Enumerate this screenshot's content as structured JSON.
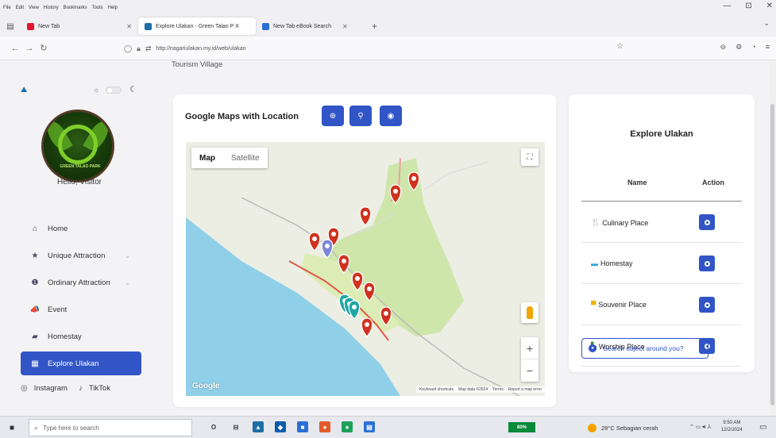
{
  "browser": {
    "menu": [
      "File",
      "Edit",
      "View",
      "History",
      "Bookmarks",
      "Tools",
      "Help"
    ],
    "tabs": [
      {
        "title": "New Tab",
        "active": false,
        "favicon_color": "#e0162b"
      },
      {
        "title": "Explore Ulakan - Green Talao P X",
        "active": true,
        "favicon_color": "#1d6fa5"
      },
      {
        "title": "New Tab eBook Search",
        "active": false,
        "favicon_color": "#2b6fd6"
      }
    ],
    "url": "http://nagariulakan.my.id/web/ulakan",
    "window_controls": [
      "—",
      "⊡",
      "✕"
    ]
  },
  "sidebar": {
    "greeting": "Hello, Visitor",
    "logo_text": "GREEN TALAO PARK",
    "items": [
      {
        "label": "Home",
        "icon": "home-icon",
        "glyph": "⌂",
        "has_caret": false,
        "active": false
      },
      {
        "label": "Unique Attraction",
        "icon": "star-icon",
        "glyph": "★",
        "has_caret": true,
        "active": false
      },
      {
        "label": "Ordinary Attraction",
        "icon": "info-icon",
        "glyph": "❶",
        "has_caret": true,
        "active": false
      },
      {
        "label": "Event",
        "icon": "megaphone-icon",
        "glyph": "📣",
        "has_caret": false,
        "active": false
      },
      {
        "label": "Homestay",
        "icon": "bed-icon",
        "glyph": "▰",
        "has_caret": false,
        "active": false
      },
      {
        "label": "Explore Ulakan",
        "icon": "map-icon",
        "glyph": "▦",
        "has_caret": false,
        "active": true
      }
    ],
    "social": [
      {
        "label": "Instagram",
        "icon": "instagram-icon"
      },
      {
        "label": "TikTok",
        "icon": "tiktok-icon"
      }
    ]
  },
  "page": {
    "crumb": "Tourism Village"
  },
  "map_card": {
    "title": "Google Maps with Location",
    "buttons": [
      "my-location",
      "set-location",
      "view"
    ],
    "map_type": {
      "map_label": "Map",
      "satellite_label": "Satellite"
    },
    "attribution": [
      "Keyboard shortcuts",
      "Map data ©2024",
      "Terms",
      "Report a map error"
    ],
    "logo": "Google"
  },
  "explore": {
    "title": "Explore Ulakan",
    "col_name": "Name",
    "col_action": "Action",
    "rows": [
      {
        "label": "Culinary Place",
        "icon": "culinary-icon",
        "glyph": "🍴",
        "color": "#d33a2c"
      },
      {
        "label": "Homestay",
        "icon": "homestay-icon",
        "glyph": "▬",
        "color": "#2aa8d8"
      },
      {
        "label": "Souvenir Place",
        "icon": "souvenir-icon",
        "glyph": "▀",
        "color": "#f2b300"
      },
      {
        "label": "Worship Place",
        "icon": "worship-icon",
        "glyph": "▙",
        "color": "#2f8f3a"
      }
    ],
    "search_label": "Search object around you?"
  },
  "taskbar": {
    "search_placeholder": "Type here to search",
    "battery": "80%",
    "weather": "28°C Sebagian cerah",
    "time": "9:50 AM",
    "date": "12/2/2024"
  },
  "colors": {
    "accent": "#3155c6",
    "map_land": "#eceee4",
    "map_sea": "#8fd0e8",
    "map_green": "#cfe6ab",
    "marker_red": "#d0321f",
    "marker_teal": "#1fa6a5",
    "marker_purple": "#7c86d8"
  }
}
